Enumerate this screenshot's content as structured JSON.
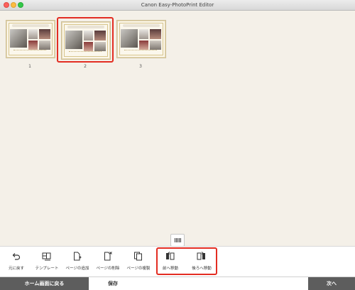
{
  "window": {
    "title": "Canon Easy-PhotoPrint Editor"
  },
  "pages": [
    {
      "number": "1",
      "selected": false
    },
    {
      "number": "2",
      "selected": true
    },
    {
      "number": "3",
      "selected": false
    }
  ],
  "toolbar": {
    "undo": "元に戻す",
    "template": "テンプレート",
    "add_page": "ページの追加",
    "delete_page": "ページの削除",
    "duplicate_page": "ページの複製",
    "move_forward": "前へ移動",
    "move_backward": "後ろへ移動"
  },
  "bottom": {
    "home": "ホーム画面に戻る",
    "save": "保存",
    "next": "次へ"
  },
  "colors": {
    "highlight": "#e32d22",
    "background": "#f4f0e8",
    "dark_button": "#5d5d5d"
  },
  "icons": [
    "undo-icon",
    "template-icon",
    "add-page-icon",
    "delete-page-icon",
    "duplicate-page-icon",
    "move-forward-icon",
    "move-backward-icon",
    "grid-toggle-icon"
  ]
}
